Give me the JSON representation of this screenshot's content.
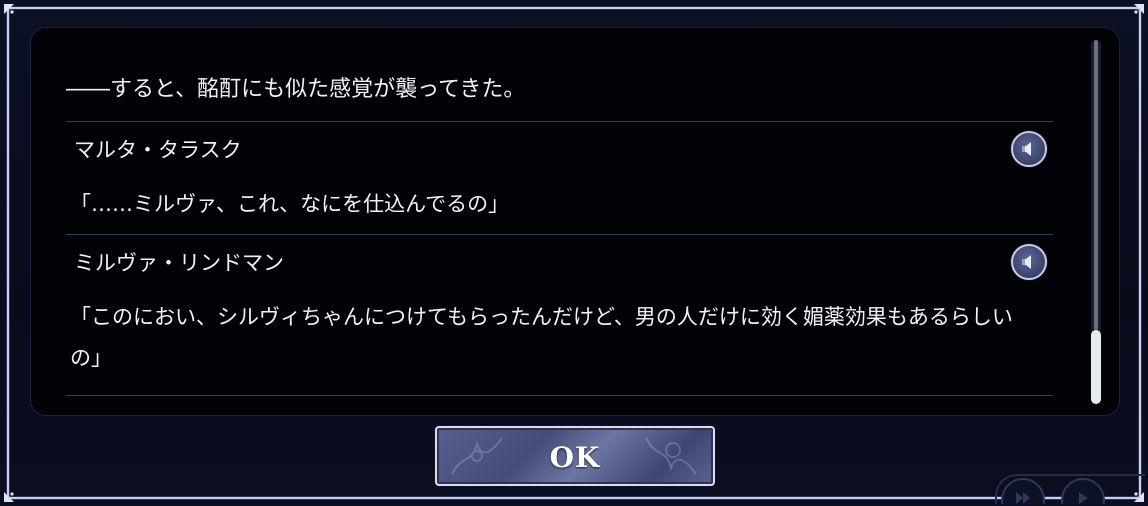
{
  "log": {
    "narration": "――すると、酩酊にも似た感覚が襲ってきた。",
    "entries": [
      {
        "speaker": "マルタ・タラスク",
        "line": "「……ミルヴァ、これ、なにを仕込んでるの」",
        "voice_icon": "speaker-icon"
      },
      {
        "speaker": "ミルヴァ・リンドマン",
        "line": "「このにおい、シルヴィちゃんにつけてもらったんだけど、男の人だけに効く媚薬効果もあるらしいの」",
        "voice_icon": "speaker-icon"
      }
    ],
    "scroll_position": 1.0
  },
  "ok_button": {
    "label": "OK"
  },
  "colors": {
    "frame_border": "#c9cfe6",
    "panel_bg": "#020307",
    "button_fill": "#57608c",
    "divider": "#3a3f52"
  }
}
